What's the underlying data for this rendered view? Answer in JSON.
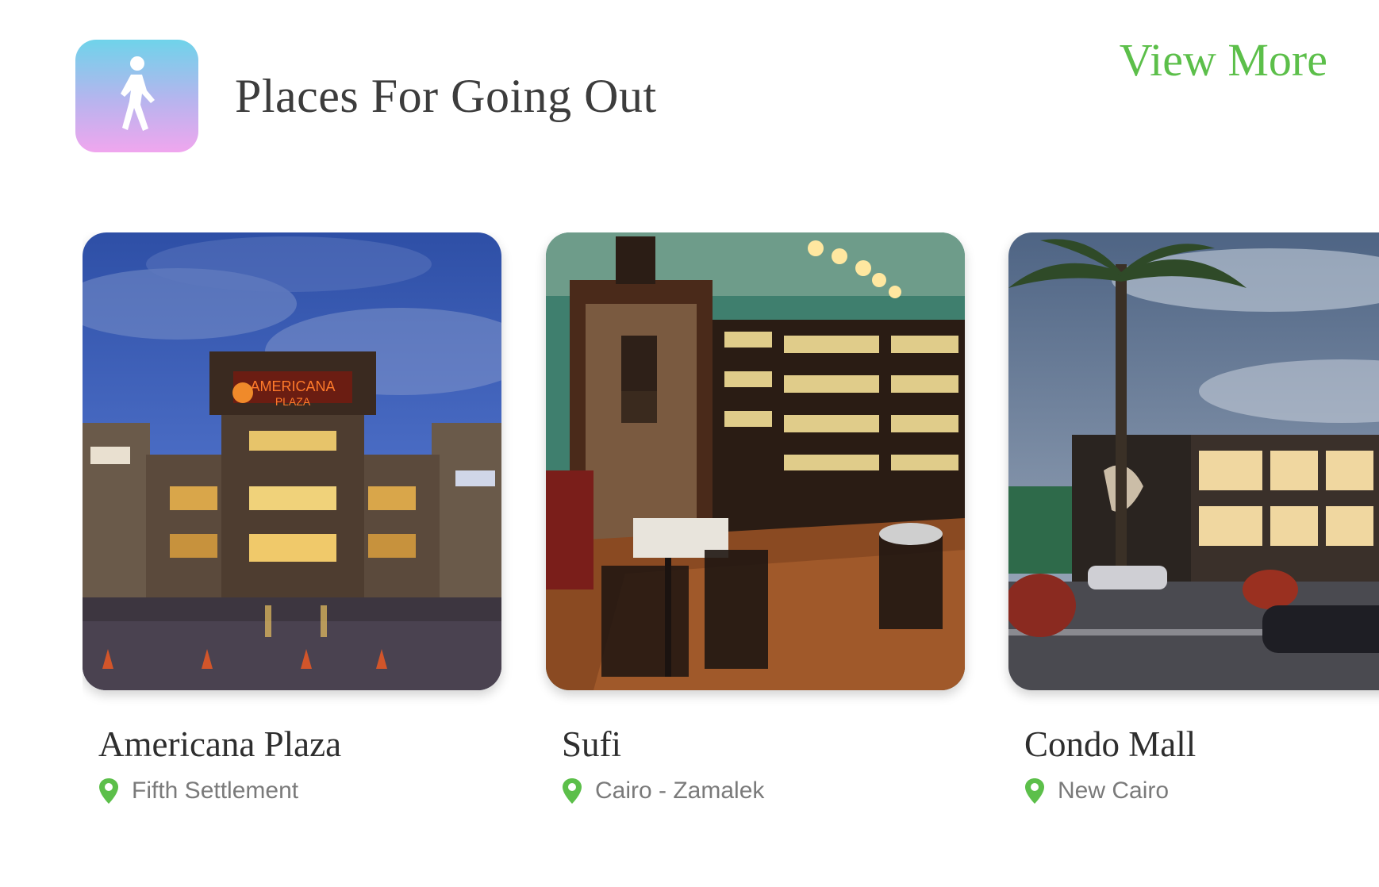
{
  "header": {
    "icon": "walking-person-icon",
    "title": "Places For Going Out",
    "view_more_label": "View More"
  },
  "colors": {
    "accent_green": "#5cbf4a",
    "icon_gradient_top": "#6fd3ea",
    "icon_gradient_bottom": "#f0a6ee"
  },
  "places": [
    {
      "name": "Americana Plaza",
      "location": "Fifth Settlement",
      "location_icon": "map-pin-icon"
    },
    {
      "name": "Sufi",
      "location": "Cairo - Zamalek",
      "location_icon": "map-pin-icon"
    },
    {
      "name": "Condo Mall",
      "location": "New Cairo",
      "location_icon": "map-pin-icon"
    }
  ]
}
